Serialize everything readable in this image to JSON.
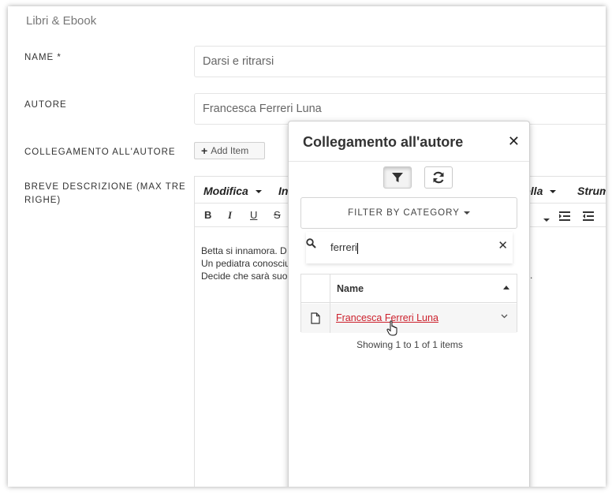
{
  "section_title": "Libri & Ebook",
  "form": {
    "name_label": "NAME *",
    "name_value": "Darsi e ritrarsi",
    "author_label": "AUTORE",
    "author_value": "Francesca Ferreri Luna",
    "link_label": "COLLEGAMENTO ALL'AUTORE",
    "add_item_label": "Add Item",
    "desc_label_1": "BREVE DESCRIZIONE (MAX TRE",
    "desc_label_2": "RIGHE)"
  },
  "editor": {
    "menus": [
      "Modifica",
      "In",
      "ella",
      "Strum"
    ],
    "toolbar": [
      "B",
      "I",
      "U",
      "S"
    ],
    "lines": [
      "Betta si innamora. D",
      "Un pediatra conosciu",
      "Decide che sarà suo"
    ],
    "trailing_period": "."
  },
  "popup": {
    "title": "Collegamento all'autore",
    "filter_label": "FILTER BY CATEGORY",
    "search_value": "ferreri",
    "column_name": "Name",
    "rows": [
      {
        "name": "Francesca Ferreri Luna"
      }
    ],
    "status": "Showing 1 to 1 of 1 items"
  },
  "icons": {
    "close": "close-icon",
    "filter": "filter-icon",
    "refresh": "refresh-icon",
    "search": "search-icon",
    "file": "file-icon",
    "chevron": "chevron-down-icon",
    "hand": "hand-cursor-icon"
  },
  "colors": {
    "link": "#cc1f2b"
  }
}
